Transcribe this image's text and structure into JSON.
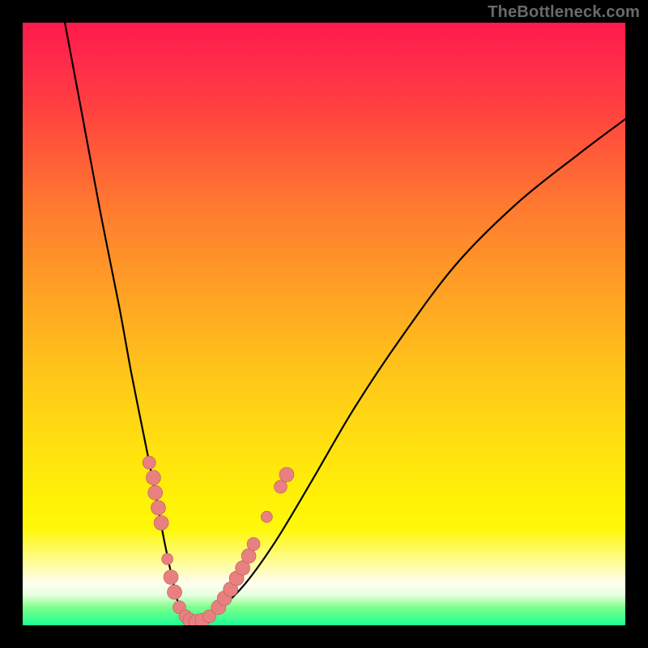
{
  "watermark": "TheBottleneck.com",
  "colors": {
    "curve": "#000000",
    "bead_fill": "#e98080",
    "bead_stroke": "#b55c5c",
    "frame": "#000000"
  },
  "chart_data": {
    "type": "line",
    "title": "",
    "xlabel": "",
    "ylabel": "",
    "xlim": [
      0,
      100
    ],
    "ylim": [
      0,
      100
    ],
    "grid": false,
    "legend": false,
    "series": [
      {
        "name": "bottleneck-curve",
        "x": [
          7,
          10,
          13,
          16,
          18,
          20,
          22,
          23.5,
          25,
          26,
          27,
          28,
          30,
          33,
          37,
          42,
          48,
          55,
          63,
          72,
          82,
          92,
          100
        ],
        "y": [
          100,
          84,
          68,
          53,
          42,
          32,
          22,
          14,
          7,
          3,
          1,
          0.5,
          1,
          3,
          7,
          14,
          24,
          36,
          48,
          60,
          70,
          78,
          84
        ]
      }
    ],
    "annotations": {
      "beads_left": [
        {
          "x": 21.0,
          "y": 27.0,
          "size": 8
        },
        {
          "x": 21.7,
          "y": 24.5,
          "size": 9
        },
        {
          "x": 22.0,
          "y": 22.0,
          "size": 9
        },
        {
          "x": 22.5,
          "y": 19.5,
          "size": 9
        },
        {
          "x": 23.0,
          "y": 17.0,
          "size": 9
        },
        {
          "x": 24.0,
          "y": 11.0,
          "size": 7
        },
        {
          "x": 24.6,
          "y": 8.0,
          "size": 9
        },
        {
          "x": 25.2,
          "y": 5.5,
          "size": 9
        },
        {
          "x": 26.0,
          "y": 3.0,
          "size": 8
        },
        {
          "x": 27.0,
          "y": 1.5,
          "size": 8
        }
      ],
      "beads_bottom": [
        {
          "x": 27.8,
          "y": 0.8,
          "size": 9
        },
        {
          "x": 28.8,
          "y": 0.6,
          "size": 9
        },
        {
          "x": 29.8,
          "y": 0.8,
          "size": 9
        }
      ],
      "beads_right": [
        {
          "x": 31.0,
          "y": 1.5,
          "size": 8
        },
        {
          "x": 32.5,
          "y": 3.0,
          "size": 9
        },
        {
          "x": 33.5,
          "y": 4.5,
          "size": 9
        },
        {
          "x": 34.5,
          "y": 6.0,
          "size": 9
        },
        {
          "x": 35.5,
          "y": 7.8,
          "size": 9
        },
        {
          "x": 36.5,
          "y": 9.5,
          "size": 9
        },
        {
          "x": 37.5,
          "y": 11.5,
          "size": 9
        },
        {
          "x": 38.3,
          "y": 13.5,
          "size": 8
        },
        {
          "x": 40.5,
          "y": 18.0,
          "size": 7
        },
        {
          "x": 42.8,
          "y": 23.0,
          "size": 8
        },
        {
          "x": 43.8,
          "y": 25.0,
          "size": 9
        }
      ]
    }
  }
}
